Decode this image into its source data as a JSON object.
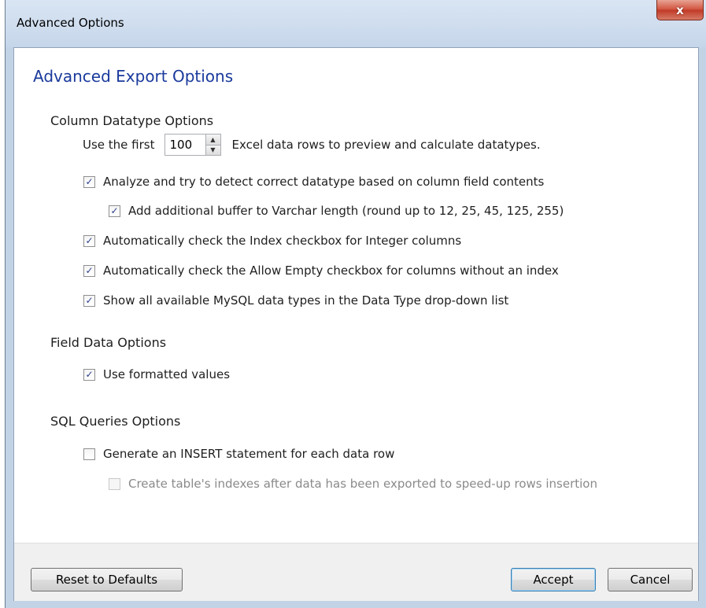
{
  "window": {
    "title": "Advanced Options",
    "close_label": "x"
  },
  "heading": "Advanced Export Options",
  "column_datatype": {
    "title": "Column Datatype Options",
    "preview_prefix": "Use the first",
    "preview_rows_value": "100",
    "preview_suffix": "Excel data rows to preview and calculate datatypes.",
    "options": [
      {
        "label": "Analyze and try to detect correct datatype based on column field contents",
        "checked": true
      },
      {
        "label": "Add additional buffer to Varchar length (round up to 12, 25, 45, 125, 255)",
        "checked": true
      },
      {
        "label": "Automatically check the Index checkbox for Integer columns",
        "checked": true
      },
      {
        "label": "Automatically check the Allow Empty checkbox for columns without an index",
        "checked": true
      },
      {
        "label": "Show all available MySQL data types in the Data Type drop-down list",
        "checked": true
      }
    ]
  },
  "field_data": {
    "title": "Field Data Options",
    "options": [
      {
        "label": "Use formatted values",
        "checked": true
      }
    ]
  },
  "sql_queries": {
    "title": "SQL Queries Options",
    "options": [
      {
        "label": "Generate an INSERT statement for each data row",
        "checked": false
      },
      {
        "label": "Create table's indexes after data has been exported to speed-up rows insertion",
        "checked": false,
        "disabled": true
      }
    ]
  },
  "footer": {
    "reset_label": "Reset to Defaults",
    "accept_label": "Accept",
    "cancel_label": "Cancel"
  }
}
